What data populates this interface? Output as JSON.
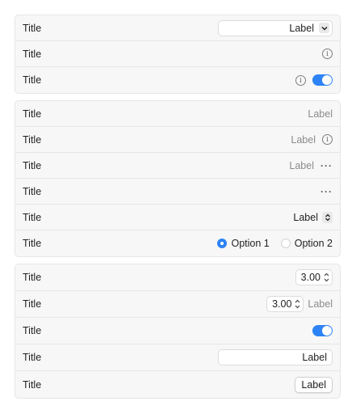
{
  "group1": {
    "rows": [
      {
        "title": "Title",
        "popup_value": "Label"
      },
      {
        "title": "Title"
      },
      {
        "title": "Title"
      }
    ]
  },
  "group2": {
    "rows": [
      {
        "title": "Title",
        "value": "Label"
      },
      {
        "title": "Title",
        "value": "Label"
      },
      {
        "title": "Title",
        "value": "Label"
      },
      {
        "title": "Title"
      },
      {
        "title": "Title",
        "value": "Label"
      },
      {
        "title": "Title",
        "options": [
          "Option 1",
          "Option 2"
        ],
        "selected": "Option 1"
      }
    ]
  },
  "group3": {
    "rows": [
      {
        "title": "Title",
        "stepper_value": "3.00"
      },
      {
        "title": "Title",
        "stepper_value": "3.00",
        "label": "Label"
      },
      {
        "title": "Title",
        "toggle_on": true
      },
      {
        "title": "Title",
        "textfield_value": "Label"
      },
      {
        "title": "Title",
        "button_label": "Label"
      }
    ]
  },
  "colors": {
    "accent": "#2d83f6"
  },
  "icons": [
    "chevron-down-icon",
    "info-icon",
    "more-icon",
    "up-down-chevron-icon",
    "stepper-arrows-icon"
  ]
}
